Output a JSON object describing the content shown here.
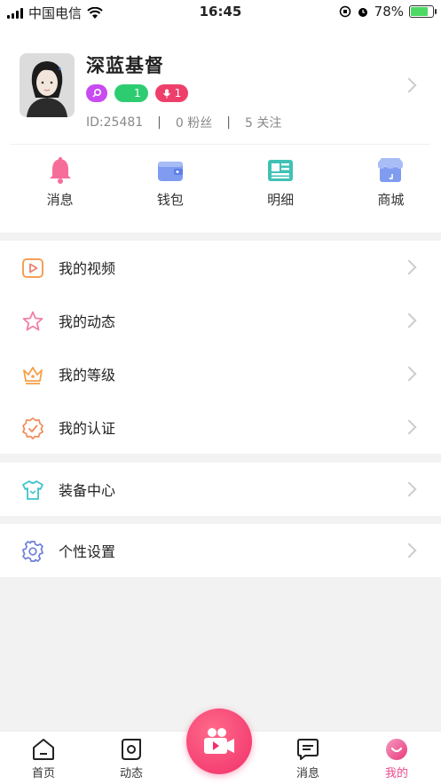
{
  "status_bar": {
    "carrier": "中国电信",
    "time": "16:45",
    "battery": "78%",
    "battery_level": 0.78
  },
  "profile": {
    "username": "深蓝基督",
    "badges": [
      {
        "icon": "search-badge-icon",
        "value": ""
      },
      {
        "icon": "moon-badge-icon",
        "value": "1"
      },
      {
        "icon": "mic-badge-icon",
        "value": "1"
      }
    ],
    "id_text": "ID:25481",
    "fans_text": "0 粉丝",
    "follow_text": "5 关注"
  },
  "shortcuts": [
    {
      "label": "消息",
      "icon": "bell-icon"
    },
    {
      "label": "钱包",
      "icon": "wallet-icon"
    },
    {
      "label": "明细",
      "icon": "newspaper-icon"
    },
    {
      "label": "商城",
      "icon": "shop-icon"
    }
  ],
  "menu": {
    "group1": [
      {
        "label": "我的视频",
        "icon": "video-icon"
      },
      {
        "label": "我的动态",
        "icon": "star-icon"
      },
      {
        "label": "我的等级",
        "icon": "crown-icon"
      },
      {
        "label": "我的认证",
        "icon": "certified-icon"
      }
    ],
    "group2": [
      {
        "label": "装备中心",
        "icon": "tshirt-icon"
      }
    ],
    "group3": [
      {
        "label": "个性设置",
        "icon": "gear-icon"
      }
    ]
  },
  "tabbar": [
    {
      "label": "首页",
      "icon": "home-icon"
    },
    {
      "label": "动态",
      "icon": "moments-icon"
    },
    {
      "label": "消息",
      "icon": "message-icon"
    },
    {
      "label": "我的",
      "icon": "profile-icon",
      "active": true
    }
  ],
  "colors": {
    "accent": "#ec4a8a",
    "center_button": "#f0306a",
    "badge_purple": "#c84af0",
    "badge_green": "#2ecc71",
    "badge_pink": "#ee3f6b"
  }
}
